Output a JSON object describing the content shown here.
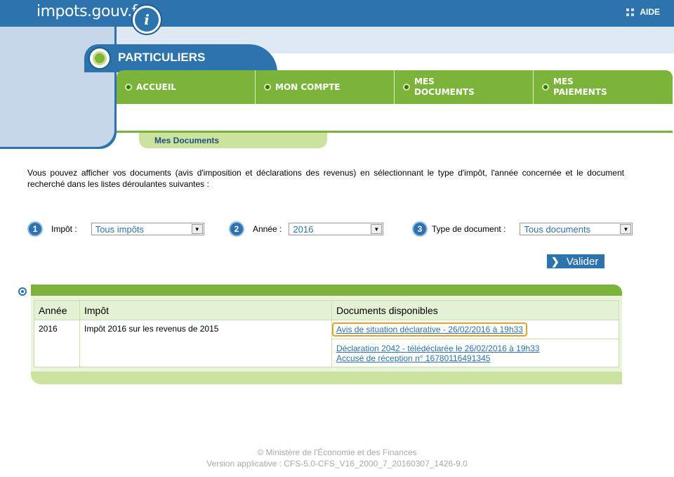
{
  "header": {
    "logo_text": "impots.gouv.fr",
    "logo_mark": "i",
    "aide_label": "AIDE"
  },
  "section": {
    "title": "PARTICULIERS"
  },
  "nav": {
    "items": [
      {
        "label": "ACCUEIL"
      },
      {
        "label": "MON COMPTE"
      },
      {
        "label": "MES\nDOCUMENTS"
      },
      {
        "label": "MES\nPAIEMENTS"
      }
    ]
  },
  "subtab": {
    "label": "Mes Documents"
  },
  "intro_text": "Vous pouvez afficher vos documents (avis d'imposition et déclarations des revenus) en sélectionnant le type d'impôt, l'année concernée et le document recherché dans les listes déroulantes suivantes :",
  "filters": [
    {
      "num": "1",
      "label": "Impôt :",
      "value": "Tous impôts"
    },
    {
      "num": "2",
      "label": "Année :",
      "value": "2016"
    },
    {
      "num": "3",
      "label": "Type de document :",
      "value": "Tous documents"
    }
  ],
  "valider_label": "Valider",
  "table": {
    "headers": [
      "Année",
      "Impôt",
      "Documents disponibles"
    ],
    "row": {
      "annee": "2016",
      "impot": "Impôt 2016 sur les revenus de 2015",
      "docs": [
        "Avis de situation déclarative - 26/02/2016 à 19h33",
        "Déclaration 2042 - télédéclarée le 26/02/2016 à 19h33",
        "Accusé de réception n° 16780116491345"
      ]
    }
  },
  "footer": {
    "line1": "© Ministère de l'Économie et des Finances",
    "line2": "Version applicative : CFS-5.0-CFS_V16_2000_7_20160307_1426-9.0"
  },
  "colors": {
    "blue": "#2d73ad",
    "green": "#7bb33b",
    "highlight": "#f0a020"
  }
}
